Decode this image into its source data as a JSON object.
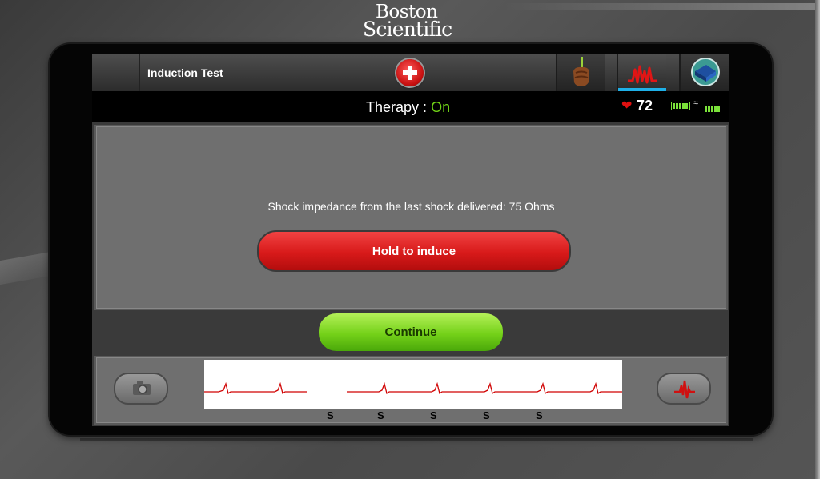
{
  "brand": {
    "line1": "Boston",
    "line2": "Scientific"
  },
  "header": {
    "title": "Induction Test",
    "emergency_icon": "emergency-cross-icon",
    "tabs": [
      {
        "name": "hand-tool-icon",
        "active": false
      },
      {
        "name": "ecg-waveform-icon",
        "active": true
      },
      {
        "name": "device-programmer-icon",
        "active": false
      }
    ]
  },
  "status": {
    "therapy_label": "Therapy :",
    "therapy_value": "On",
    "heart_rate": "72",
    "icons": [
      "heart-icon",
      "battery-icon",
      "telemetry-icon",
      "signal-strength-icon"
    ]
  },
  "main": {
    "message": "Shock impedance from the last shock delivered: 75 Ohms",
    "induce_label": "Hold to induce",
    "continue_label": "Continue"
  },
  "ecg": {
    "markers": [
      "S",
      "S",
      "S",
      "S",
      "S"
    ],
    "camera_icon": "camera-icon",
    "ecg_icon": "ecg-waveform-icon"
  },
  "colors": {
    "accent_active_tab": "#1eb0e8",
    "therapy_on": "#6fd016",
    "induce_button": "#d81a1a",
    "continue_button": "#74d119",
    "ecg_trace": "#d00000"
  }
}
